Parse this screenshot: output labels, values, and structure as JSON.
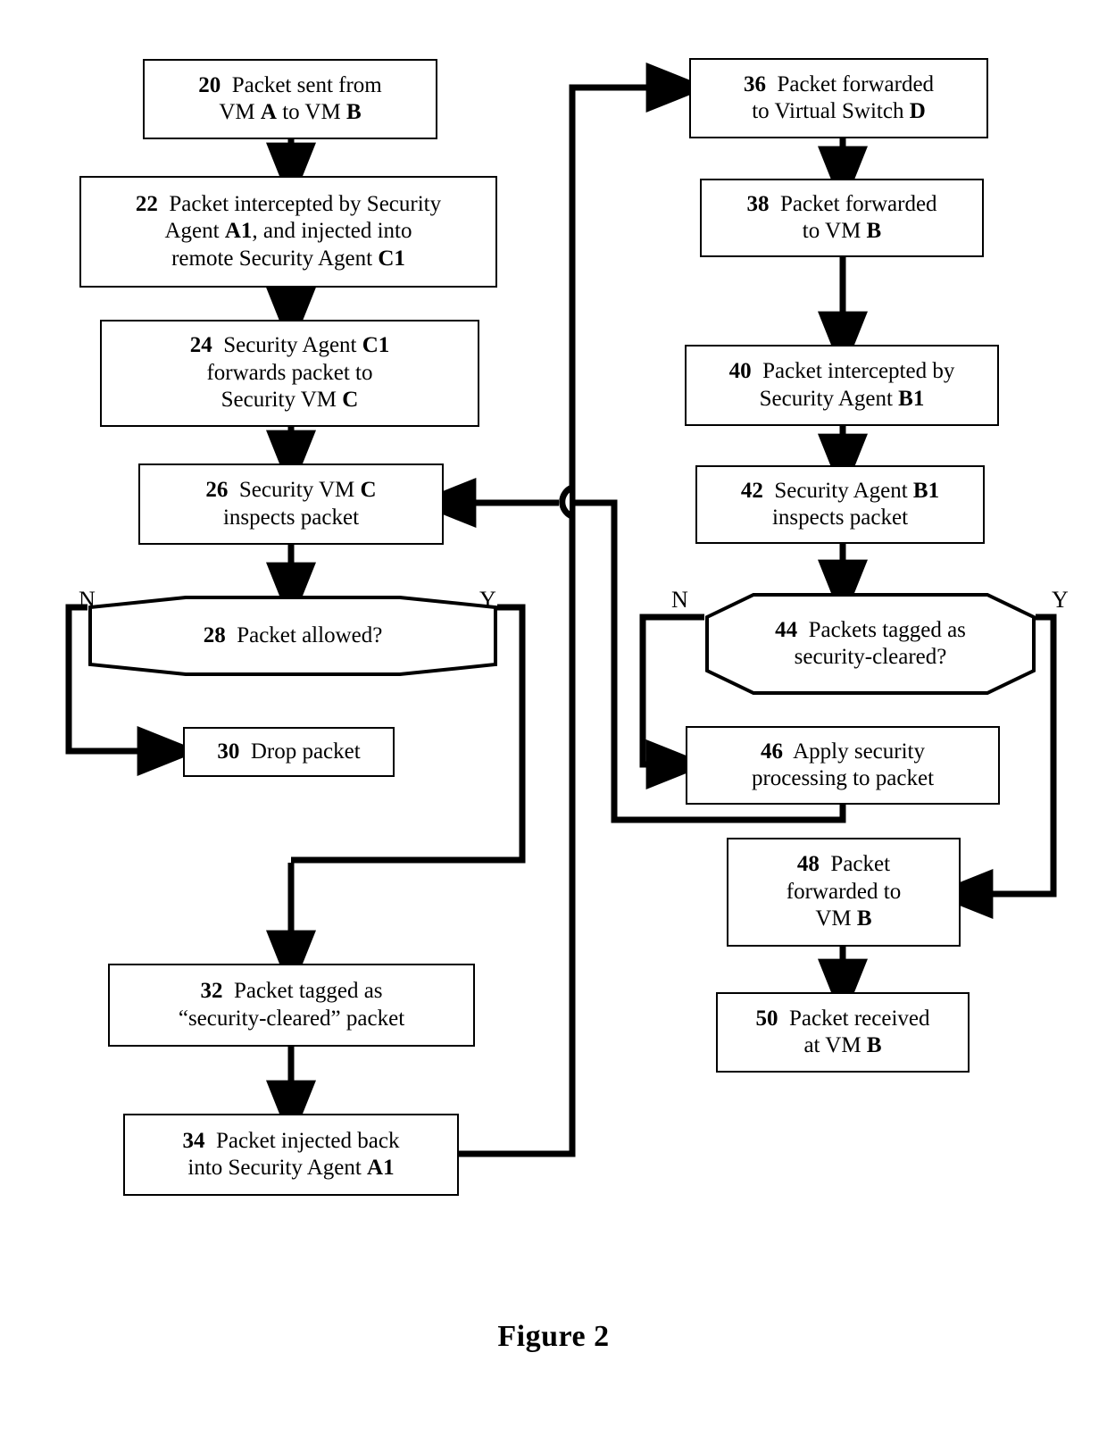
{
  "figure": {
    "caption": "Figure 2"
  },
  "nodes": [
    {
      "id": "n20",
      "num": "20",
      "line1": "Packet sent from",
      "line2": "VM A to VM B"
    },
    {
      "id": "n22",
      "num": "22",
      "line1": "Packet intercepted by Security",
      "line2": "Agent A1, and injected into",
      "line3": "remote Security Agent C1"
    },
    {
      "id": "n24",
      "num": "24",
      "line1": "Security Agent C1",
      "line2": "forwards packet to",
      "line3": "Security VM C"
    },
    {
      "id": "n26",
      "num": "26",
      "line1": "Security VM C",
      "line2": "inspects packet"
    },
    {
      "id": "n28",
      "num": "28",
      "line1": "Packet allowed?"
    },
    {
      "id": "n30",
      "num": "30",
      "line1": "Drop packet"
    },
    {
      "id": "n32",
      "num": "32",
      "line1": "Packet tagged as",
      "line2": "“security-cleared” packet"
    },
    {
      "id": "n34",
      "num": "34",
      "line1": "Packet injected back",
      "line2": "into Security Agent A1"
    },
    {
      "id": "n36",
      "num": "36",
      "line1": "Packet forwarded",
      "line2": "to Virtual Switch D"
    },
    {
      "id": "n38",
      "num": "38",
      "line1": "Packet forwarded",
      "line2": "to VM B"
    },
    {
      "id": "n40",
      "num": "40",
      "line1": "Packet intercepted by",
      "line2": "Security Agent B1"
    },
    {
      "id": "n42",
      "num": "42",
      "line1": "Security Agent B1",
      "line2": "inspects packet"
    },
    {
      "id": "n44",
      "num": "44",
      "line1": "Packets tagged as",
      "line2": "security-cleared?"
    },
    {
      "id": "n46",
      "num": "46",
      "line1": "Apply security",
      "line2": "processing to packet"
    },
    {
      "id": "n48",
      "num": "48",
      "line1": "Packet",
      "line2": "forwarded to",
      "line3": "VM B"
    },
    {
      "id": "n50",
      "num": "50",
      "line1": "Packet received",
      "line2": "at VM B"
    }
  ],
  "branch_labels": {
    "left_no": "N",
    "left_yes": "Y",
    "right_no": "N",
    "right_yes": "Y"
  },
  "colors": {
    "stroke": "#000000",
    "background": "#ffffff"
  }
}
